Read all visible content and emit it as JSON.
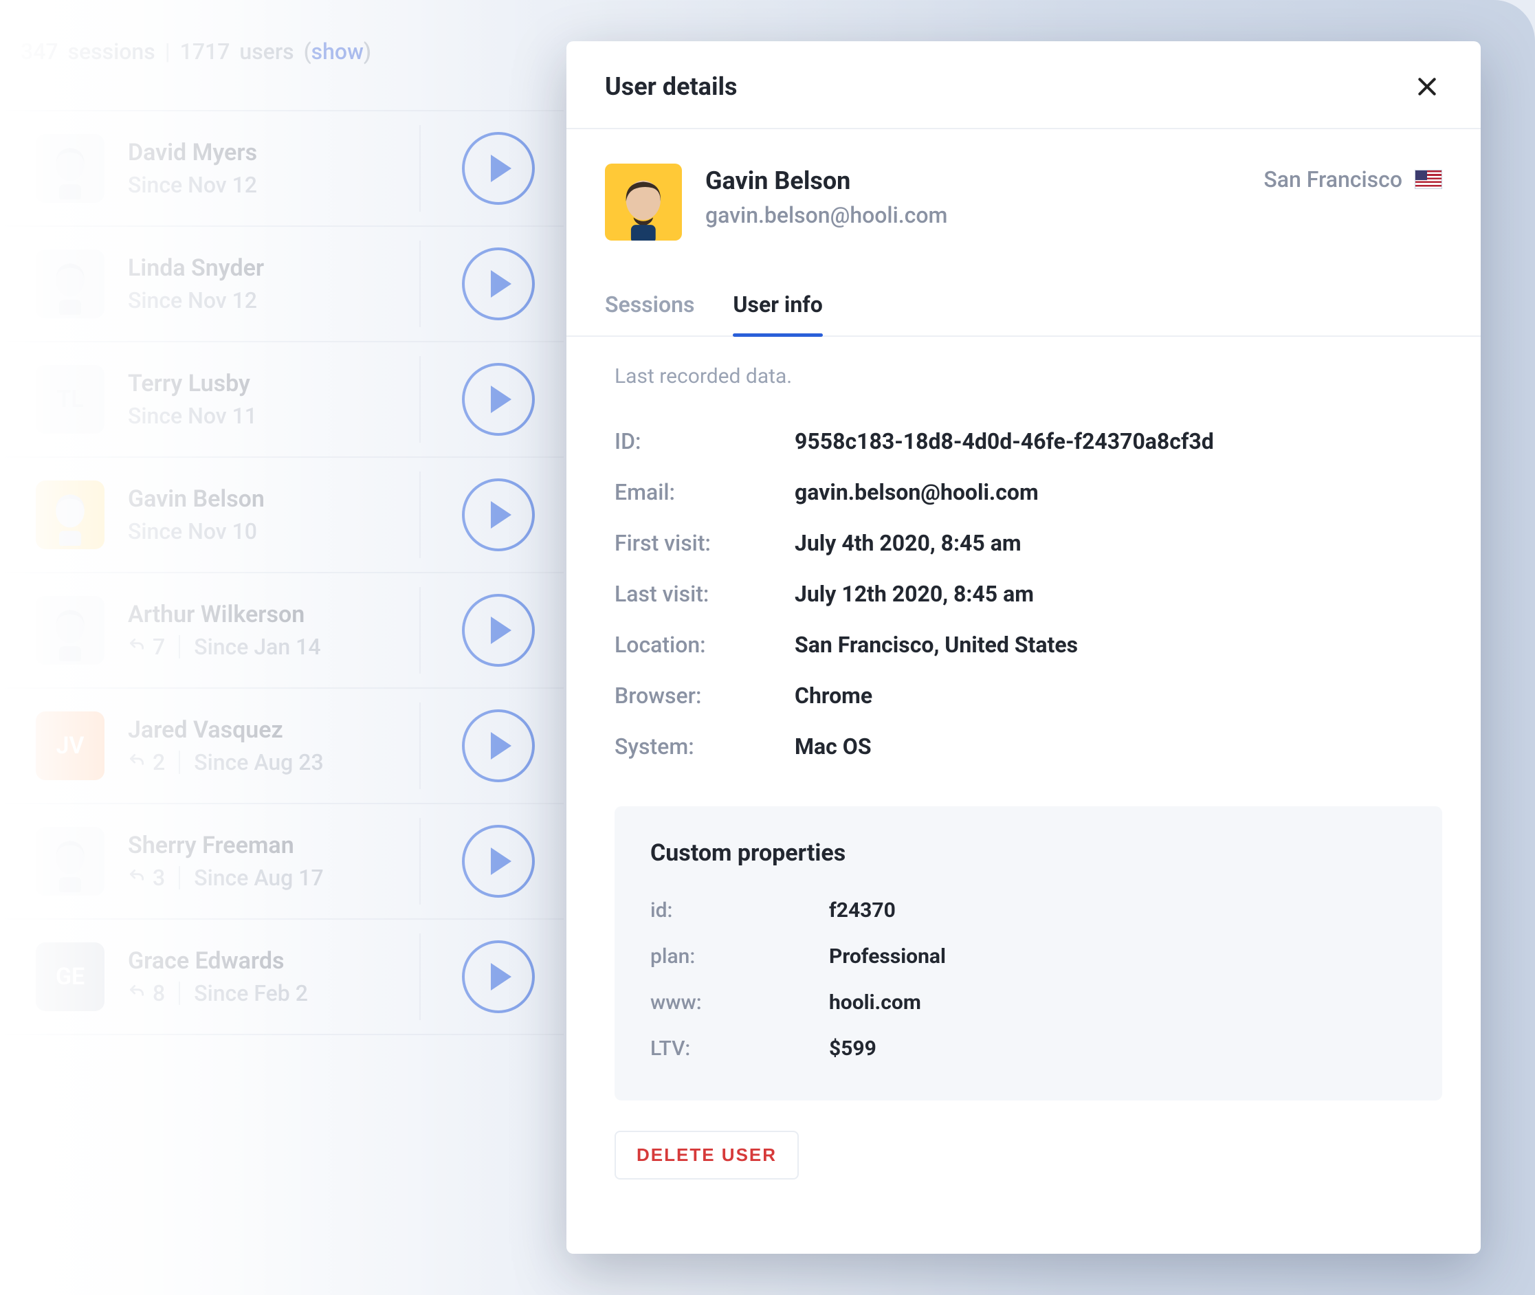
{
  "summary": {
    "sessions_count": "347",
    "sessions_label": "sessions",
    "users_count": "1717",
    "users_label": "users",
    "show_prefix": "(",
    "show_link": "show",
    "show_suffix": ")"
  },
  "users": [
    {
      "name": "David Myers",
      "sub": "Since Nov 12",
      "reply": null,
      "avatar": "photo"
    },
    {
      "name": "Linda Snyder",
      "sub": "Since Nov 12",
      "reply": null,
      "avatar": "photo"
    },
    {
      "name": "Terry Lusby",
      "sub": "Since Nov 11",
      "reply": null,
      "avatar": "initials",
      "initials": "TL"
    },
    {
      "name": "Gavin Belson",
      "sub": "Since Nov 10",
      "reply": null,
      "avatar": "yellow"
    },
    {
      "name": "Arthur Wilkerson",
      "sub": "Since Jan 14",
      "reply": "7",
      "avatar": "photo"
    },
    {
      "name": "Jared Vasquez",
      "sub": "Since Aug 23",
      "reply": "2",
      "avatar": "orange",
      "initials": "JV"
    },
    {
      "name": "Sherry Freeman",
      "sub": "Since Aug 17",
      "reply": "3",
      "avatar": "photo"
    },
    {
      "name": "Grace Edwards",
      "sub": "Since Feb 2",
      "reply": "8",
      "avatar": "grey",
      "initials": "GE"
    }
  ],
  "modal": {
    "title": "User details",
    "profile": {
      "name": "Gavin Belson",
      "email": "gavin.belson@hooli.com",
      "location": "San Francisco"
    },
    "tabs": {
      "sessions": "Sessions",
      "info": "User info"
    },
    "hint": "Last recorded data.",
    "fields": {
      "id_label": "ID:",
      "id": "9558c183-18d8-4d0d-46fe-f24370a8cf3d",
      "email_label": "Email:",
      "email": "gavin.belson@hooli.com",
      "first_label": "First visit:",
      "first": "July 4th 2020, 8:45 am",
      "last_label": "Last visit:",
      "last": "July 12th 2020, 8:45 am",
      "loc_label": "Location:",
      "loc": "San Francisco, United States",
      "browser_label": "Browser:",
      "browser": "Chrome",
      "system_label": "System:",
      "system": "Mac OS"
    },
    "custom": {
      "title": "Custom properties",
      "id_label": "id:",
      "id": "f24370",
      "plan_label": "plan:",
      "plan": "Professional",
      "www_label": "www:",
      "www": "hooli.com",
      "ltv_label": "LTV:",
      "ltv": "$599"
    },
    "delete_label": "DELETE  USER"
  }
}
